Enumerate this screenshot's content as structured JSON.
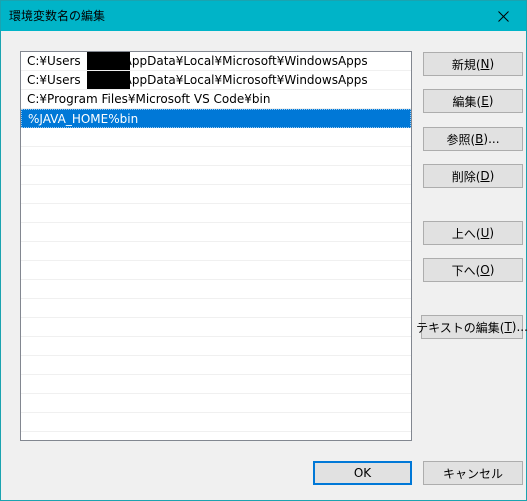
{
  "window": {
    "title": "環境変数名の編集"
  },
  "list": {
    "items": [
      {
        "prefix": "C:¥Users",
        "suffix": "AppData¥Local¥Microsoft¥WindowsApps",
        "redacted": true,
        "selected": false
      },
      {
        "prefix": "C:¥Users",
        "suffix": "AppData¥Local¥Microsoft¥WindowsApps",
        "redacted": true,
        "selected": false
      },
      {
        "prefix": "C:¥Program Files¥Microsoft VS Code¥bin",
        "suffix": "",
        "redacted": false,
        "selected": false
      },
      {
        "prefix": "%JAVA_HOME%bin",
        "suffix": "",
        "redacted": false,
        "selected": true
      }
    ],
    "empty_rows": 16
  },
  "buttons": {
    "new": {
      "label": "新規(",
      "key": "N",
      "end": ")"
    },
    "edit": {
      "label": "編集(",
      "key": "E",
      "end": ")"
    },
    "browse": {
      "label": "参照(",
      "key": "B",
      "end": ")..."
    },
    "delete": {
      "label": "削除(",
      "key": "D",
      "end": ")"
    },
    "up": {
      "label": "上へ(",
      "key": "U",
      "end": ")"
    },
    "down": {
      "label": "下へ(",
      "key": "O",
      "end": ")"
    },
    "edit_text": {
      "label": "テキストの編集(",
      "key": "T",
      "end": ")..."
    },
    "ok": {
      "label": "OK"
    },
    "cancel": {
      "label": "キャンセル"
    }
  },
  "colors": {
    "titlebar": "#00b4c8",
    "selection": "#0078d7",
    "default_button_border": "#0078d7"
  }
}
